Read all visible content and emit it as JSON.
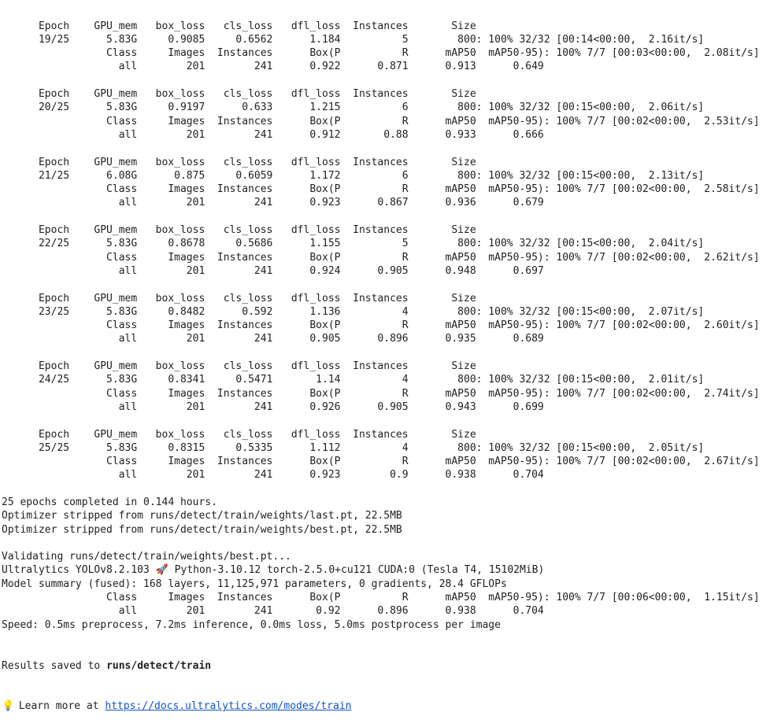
{
  "training_log": {
    "lines": [
      "      Epoch    GPU_mem   box_loss   cls_loss   dfl_loss  Instances       Size",
      "      19/25      5.83G     0.9085     0.6562      1.184          5        800: 100% 32/32 [00:14<00:00,  2.16it/s]",
      "                 Class     Images  Instances      Box(P          R      mAP50  mAP50-95): 100% 7/7 [00:03<00:00,  2.08it/s]",
      "                   all        201        241      0.922      0.871      0.913      0.649",
      "",
      "      Epoch    GPU_mem   box_loss   cls_loss   dfl_loss  Instances       Size",
      "      20/25      5.83G     0.9197      0.633      1.215          6        800: 100% 32/32 [00:15<00:00,  2.06it/s]",
      "                 Class     Images  Instances      Box(P          R      mAP50  mAP50-95): 100% 7/7 [00:02<00:00,  2.53it/s]",
      "                   all        201        241      0.912       0.88      0.933      0.666",
      "",
      "      Epoch    GPU_mem   box_loss   cls_loss   dfl_loss  Instances       Size",
      "      21/25      6.08G      0.875     0.6059      1.172          6        800: 100% 32/32 [00:15<00:00,  2.13it/s]",
      "                 Class     Images  Instances      Box(P          R      mAP50  mAP50-95): 100% 7/7 [00:02<00:00,  2.58it/s]",
      "                   all        201        241      0.923      0.867      0.936      0.679",
      "",
      "      Epoch    GPU_mem   box_loss   cls_loss   dfl_loss  Instances       Size",
      "      22/25      5.83G     0.8678     0.5686      1.155          5        800: 100% 32/32 [00:15<00:00,  2.04it/s]",
      "                 Class     Images  Instances      Box(P          R      mAP50  mAP50-95): 100% 7/7 [00:02<00:00,  2.62it/s]",
      "                   all        201        241      0.924      0.905      0.948      0.697",
      "",
      "      Epoch    GPU_mem   box_loss   cls_loss   dfl_loss  Instances       Size",
      "      23/25      5.83G     0.8482      0.592      1.136          4        800: 100% 32/32 [00:15<00:00,  2.07it/s]",
      "                 Class     Images  Instances      Box(P          R      mAP50  mAP50-95): 100% 7/7 [00:02<00:00,  2.60it/s]",
      "                   all        201        241      0.905      0.896      0.935      0.689",
      "",
      "      Epoch    GPU_mem   box_loss   cls_loss   dfl_loss  Instances       Size",
      "      24/25      5.83G     0.8341     0.5471       1.14          4        800: 100% 32/32 [00:15<00:00,  2.01it/s]",
      "                 Class     Images  Instances      Box(P          R      mAP50  mAP50-95): 100% 7/7 [00:02<00:00,  2.74it/s]",
      "                   all        201        241      0.926      0.905      0.943      0.699",
      "",
      "      Epoch    GPU_mem   box_loss   cls_loss   dfl_loss  Instances       Size",
      "      25/25      5.83G     0.8315     0.5335      1.112          4        800: 100% 32/32 [00:15<00:00,  2.05it/s]",
      "                 Class     Images  Instances      Box(P          R      mAP50  mAP50-95): 100% 7/7 [00:02<00:00,  2.67it/s]",
      "                   all        201        241      0.923        0.9      0.938      0.704",
      "",
      "25 epochs completed in 0.144 hours.",
      "Optimizer stripped from runs/detect/train/weights/last.pt, 22.5MB",
      "Optimizer stripped from runs/detect/train/weights/best.pt, 22.5MB",
      "",
      "Validating runs/detect/train/weights/best.pt...",
      "Ultralytics YOLOv8.2.103 🚀 Python-3.10.12 torch-2.5.0+cu121 CUDA:0 (Tesla T4, 15102MiB)",
      "Model summary (fused): 168 layers, 11,125,971 parameters, 0 gradients, 28.4 GFLOPs",
      "                 Class     Images  Instances      Box(P          R      mAP50  mAP50-95): 100% 7/7 [00:06<00:00,  1.15it/s]",
      "                   all        201        241       0.92      0.896      0.938      0.704",
      "Speed: 0.5ms preprocess, 7.2ms inference, 0.0ms loss, 5.0ms postprocess per image"
    ],
    "results_prefix": "Results saved to ",
    "results_path": "runs/detect/train",
    "learn_icon": "lightbulb-icon",
    "learn_glyph": "💡",
    "learn_text": " Learn more at ",
    "learn_link": "https://docs.ultralytics.com/modes/train"
  }
}
